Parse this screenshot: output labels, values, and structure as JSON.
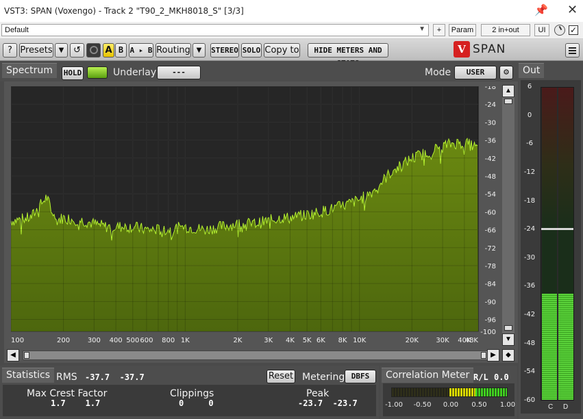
{
  "window": {
    "title": "VST3: SPAN (Voxengo) - Track 2 \"T90_2_MKH8018_S\" [3/3]",
    "pin_icon": "pin-icon",
    "close_icon": "close-icon"
  },
  "host": {
    "preset": "Default",
    "plus": "+",
    "param": "Param",
    "io": "2 in+out",
    "ui": "UI",
    "checked": "✓"
  },
  "toolbar": {
    "help": "?",
    "presets": "Presets",
    "dropdown": "▼",
    "undo": "↺",
    "a": "A",
    "b": "B",
    "a_to_b": "A ▸ B",
    "routing": "Routing",
    "stereo": "STEREO",
    "solo": "SOLO",
    "copy_to": "Copy to",
    "hide_meters": "HIDE METERS AND STATS",
    "logo_letter": "V",
    "logo_name": "SPAN"
  },
  "spectrum": {
    "tab": "Spectrum",
    "hold": "HOLD",
    "underlay_label": "Underlay",
    "underlay_value": "---",
    "mode_label": "Mode",
    "mode_value": "USER",
    "gear_icon": "gear-icon"
  },
  "chart_data": {
    "type": "area",
    "x_scale": "log",
    "xlim": [
      100,
      48000
    ],
    "ylim": [
      -100,
      -18
    ],
    "x_ticks": [
      {
        "v": 100,
        "label": "100"
      },
      {
        "v": 200,
        "label": "200"
      },
      {
        "v": 300,
        "label": "300"
      },
      {
        "v": 400,
        "label": "400"
      },
      {
        "v": 500,
        "label": "500"
      },
      {
        "v": 600,
        "label": "600"
      },
      {
        "v": 800,
        "label": "800"
      },
      {
        "v": 1000,
        "label": "1K"
      },
      {
        "v": 2000,
        "label": "2K"
      },
      {
        "v": 3000,
        "label": "3K"
      },
      {
        "v": 4000,
        "label": "4K"
      },
      {
        "v": 5000,
        "label": "5K"
      },
      {
        "v": 6000,
        "label": "6K"
      },
      {
        "v": 8000,
        "label": "8K"
      },
      {
        "v": 10000,
        "label": "10K"
      },
      {
        "v": 20000,
        "label": "20K"
      },
      {
        "v": 30000,
        "label": "30K"
      },
      {
        "v": 40000,
        "label": "40K"
      },
      {
        "v": 48000,
        "label": "48K"
      }
    ],
    "y_ticks": [
      -18,
      -24,
      -30,
      -36,
      -42,
      -48,
      -54,
      -60,
      -66,
      -72,
      -78,
      -84,
      -90,
      -96,
      -100
    ],
    "grid": true,
    "x": [
      100,
      130,
      160,
      180,
      200,
      260,
      300,
      350,
      400,
      500,
      600,
      700,
      800,
      1000,
      1300,
      1600,
      2000,
      2500,
      3000,
      3500,
      4000,
      5000,
      6000,
      7000,
      8000,
      10000,
      12000,
      15000,
      20000,
      25000,
      30000,
      35000,
      40000,
      45000,
      48000
    ],
    "y": [
      -63,
      -62,
      -55,
      -63,
      -62,
      -63,
      -64,
      -65,
      -65,
      -65,
      -66,
      -66,
      -66,
      -65,
      -66,
      -65,
      -64,
      -64,
      -63,
      -62,
      -62,
      -61,
      -60,
      -59,
      -58,
      -56,
      -53,
      -47,
      -42,
      -40,
      -38,
      -37,
      -37,
      -38,
      -39
    ]
  },
  "statistics": {
    "tab": "Statistics",
    "rms_label": "RMS",
    "rms_values": "-37.7  -37.7",
    "reset": "Reset",
    "metering_label": "Metering",
    "metering_value": "DBFS",
    "max_crest_label": "Max Crest Factor",
    "max_crest_values": "1.7    1.7",
    "clippings_label": "Clippings",
    "clippings_values": "0     0",
    "peak_label": "Peak",
    "peak_values": "-23.7  -23.7"
  },
  "correlation": {
    "tab": "Correlation Meter",
    "rl_label": "R/L",
    "rl_value": "0.0",
    "ticks": [
      "-1.00",
      "-0.50",
      "0.00",
      "0.50",
      "1.00"
    ]
  },
  "out": {
    "tab": "Out",
    "scale": [
      "6",
      "0",
      "-6",
      "-12",
      "-18",
      "-24",
      "-30",
      "-36",
      "-42",
      "-48",
      "-54",
      "-60"
    ],
    "channel_c": "C",
    "channel_d": "D",
    "level_db": -37.7,
    "peak_db": -23.7
  }
}
